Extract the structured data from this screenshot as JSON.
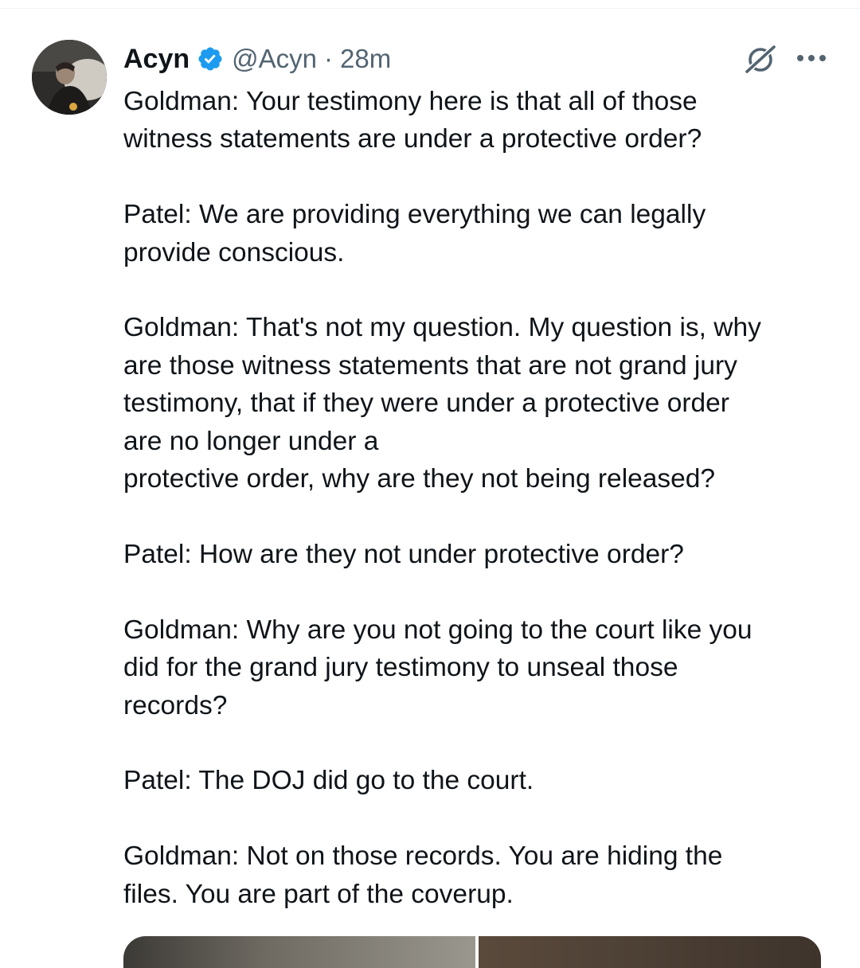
{
  "tweet": {
    "author": {
      "display_name": "Acyn",
      "handle": "@Acyn",
      "verified": true,
      "avatar_icon": "user-avatar"
    },
    "separator": "·",
    "timestamp": "28m",
    "text": "Goldman: Your testimony here is that all of those\nwitness statements are under a protective order?\n\nPatel: We are providing everything we can legally\nprovide conscious.\n\nGoldman: That's not my question. My question is, why\nare those witness statements that are not grand jury\ntestimony, that if they were under a protective order\nare no longer under a\nprotective order, why are they not being released?\n\nPatel: How are they not under protective order?\n\nGoldman: Why are you not going to the court like you\ndid for the grand jury testimony to unseal those\nrecords?\n\nPatel: The DOJ did go to the court.\n\nGoldman: Not on those records. You are hiding the\nfiles. You are part of the coverup.",
    "actions": {
      "grok_icon": "grok-icon",
      "more_icon": "more-horizontal-icon"
    },
    "colors": {
      "verified_badge": "#1d9bf0",
      "secondary_text": "#536471",
      "primary_text": "#0f1419"
    }
  }
}
